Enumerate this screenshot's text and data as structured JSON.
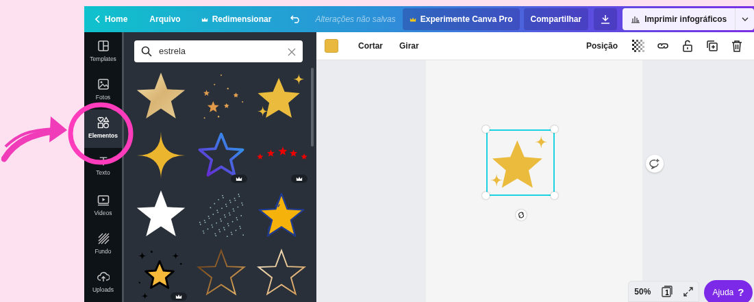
{
  "topbar": {
    "back": "Home",
    "menu": "Arquivo",
    "resize": "Redimensionar",
    "status": "Alterações não salvas",
    "pro": "Experimente Canva Pro",
    "share": "Compartilhar",
    "print": "Imprimir infográficos"
  },
  "rail": [
    {
      "label": "Templates",
      "kind": "templates",
      "selected": false
    },
    {
      "label": "Fotos",
      "kind": "photos",
      "selected": false
    },
    {
      "label": "Elementos",
      "kind": "elements",
      "selected": true
    },
    {
      "label": "Texto",
      "kind": "text",
      "selected": false
    },
    {
      "label": "Videos",
      "kind": "videos",
      "selected": false
    },
    {
      "label": "Fundo",
      "kind": "background",
      "selected": false
    },
    {
      "label": "Uploads",
      "kind": "uploads",
      "selected": false
    }
  ],
  "search": {
    "value": "estrela"
  },
  "results": [
    {
      "kind": "foil-star",
      "premium": false
    },
    {
      "kind": "scattered-stars",
      "premium": false
    },
    {
      "kind": "sparkle-star",
      "premium": false
    },
    {
      "kind": "four-point",
      "premium": false
    },
    {
      "kind": "gradient-outline",
      "premium": true
    },
    {
      "kind": "star-row",
      "premium": true
    },
    {
      "kind": "white-star",
      "premium": false
    },
    {
      "kind": "glitter",
      "premium": false
    },
    {
      "kind": "cartoon-star",
      "premium": false
    },
    {
      "kind": "doodle-star",
      "premium": true
    },
    {
      "kind": "bronze-outline",
      "premium": false
    },
    {
      "kind": "champagne-outline",
      "premium": false
    }
  ],
  "toolbar": {
    "color": "#e9b93f",
    "actions": [
      "Cortar",
      "Girar"
    ],
    "position": "Posição"
  },
  "footer": {
    "zoom": "50%",
    "page": "1",
    "help": "Ajuda",
    "help_icon": "?"
  }
}
